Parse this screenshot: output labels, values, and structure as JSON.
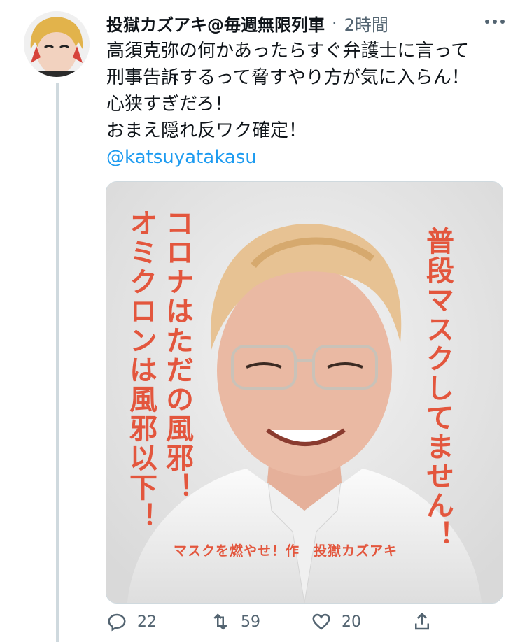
{
  "tweet": {
    "author_name": "投獄カズアキ@毎週無限列車",
    "separator": "·",
    "time": "2時間",
    "more_icon": "more-horizontal-icon",
    "text_lines": [
      "高須克弥の何かあったらすぐ弁護士に言って",
      "刑事告訴するって脅すやり方が気に入らん！",
      "心狭すぎだろ！",
      "おまえ隠れ反ワク確定！"
    ],
    "mention": "@katsuyatakasu",
    "media": {
      "text_right": "普段マスクしてません！",
      "text_left_col1": "コロナはただの風邪！",
      "text_left_col2": "オミクロンは風邪以下！",
      "credit": "マスクを燃やせ！作　投獄カズアキ"
    },
    "actions": {
      "reply_count": "22",
      "retweet_count": "59",
      "like_count": "20"
    }
  },
  "colors": {
    "accent": "#1d9bf0",
    "overlay_text": "#e3563d",
    "muted": "#536471"
  }
}
